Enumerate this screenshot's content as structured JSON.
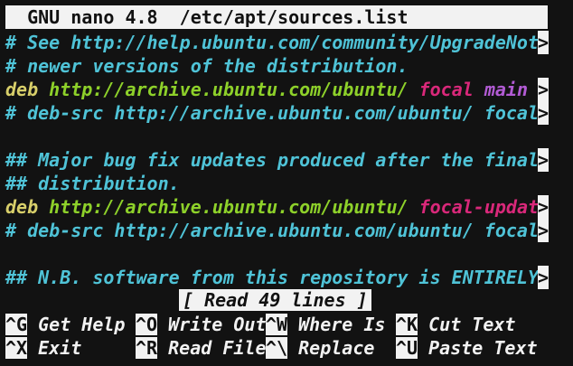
{
  "title": "  GNU nano 4.8  /etc/apt/sources.list",
  "lines": [
    {
      "a": "# See http://help.ubuntu.com/community/UpgradeNot"
    },
    {
      "a": "# newer versions of the distribution."
    },
    {
      "deb": "deb",
      "url": "http://archive.ubuntu.com/ubuntu/",
      "suite": "focal",
      "comp": "main"
    },
    {
      "a": "# deb-src http://archive.ubuntu.com/ubuntu/ focal"
    },
    {
      "a": ""
    },
    {
      "a": "## Major bug fix updates produced after the final"
    },
    {
      "a": "## distribution."
    },
    {
      "deb": "deb",
      "url": "http://archive.ubuntu.com/ubuntu/",
      "suite": "focal-updat"
    },
    {
      "a": "# deb-src http://archive.ubuntu.com/ubuntu/ focal"
    },
    {
      "a": ""
    },
    {
      "a": "## N.B. software from this repository is ENTIRELY"
    }
  ],
  "truncation_marker": ">",
  "status": "[ Read 49 lines ]",
  "shortcuts": [
    [
      {
        "key": "^G",
        "label": "Get Help"
      },
      {
        "key": "^O",
        "label": "Write Out"
      },
      {
        "key": "^W",
        "label": "Where Is"
      },
      {
        "key": "^K",
        "label": "Cut Text"
      }
    ],
    [
      {
        "key": "^X",
        "label": "Exit"
      },
      {
        "key": "^R",
        "label": "Read File"
      },
      {
        "key": "^\\",
        "label": "Replace"
      },
      {
        "key": "^U",
        "label": "Paste Text"
      }
    ]
  ]
}
